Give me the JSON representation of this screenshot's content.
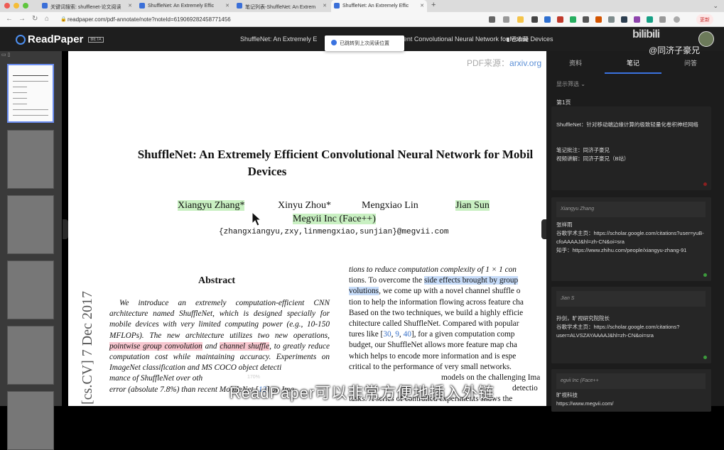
{
  "browser": {
    "tabs": [
      {
        "label": "关键词搜索: shufflenet-论文阅读"
      },
      {
        "label": "ShuffleNet: An Extremely Effic"
      },
      {
        "label": "笔记列表-ShuffleNet: An Extrem"
      },
      {
        "label": "ShuffleNet: An Extremely Effic"
      }
    ],
    "url": "readpaper.com/pdf-annotate/note?noteId=619069282458771456",
    "update_label": "更新"
  },
  "app": {
    "logo_text": "ReadPaper",
    "beta_label": "BETA",
    "doc_title": "ShuffleNet: An Extremely E",
    "doc_title_tail": "cient Convolutional Neural Network for Mobile Devices",
    "bookmark_label": "已收藏",
    "toast": "已跳转到上次阅读位置"
  },
  "overlay": {
    "watermark": "bilibili",
    "author": "@同济子豪兄",
    "caption": "ReadPaper可以非常方便地插入外链"
  },
  "pdf": {
    "source_label": "PDF来源：",
    "source_value": "arxiv.org",
    "title_line1": "ShuffleNet: An Extremely Efficient Convolutional Neural Network for Mobil",
    "title_line2": "Devices",
    "authors": [
      "Xiangyu Zhang*",
      "Xinyu Zhou*",
      "Mengxiao Lin",
      "Jian Sun"
    ],
    "affiliation": "Megvii Inc (Face++)",
    "email": "{zhangxiangyu,zxy,linmengxiao,sunjian}@megvii.com",
    "arxiv_stamp": "[cs.CV]  7 Dec 2017",
    "abstract_heading": "Abstract",
    "abstract": {
      "p1": "We introduce an extremely computation-efficient CNN architecture named ShuffleNet, which is designed specially for mobile devices with very limited computing power (e.g., 10-150 MFLOPs). The new architecture utilizes two new operations, ",
      "h1": "pointwise group convolution",
      "p2": " and ",
      "h2": "channel shuffle",
      "p3": ", to greatly reduce computation cost while maintaining accuracy. Experiments on ImageNet classification and MS COCO object detecti",
      "p4": "mance of ShuffleNet over oth",
      "p5": "error (absolute 7.8%) than recent MobileNet [",
      "cite": "12",
      "p6": "] on Ima-"
    },
    "right_lines": [
      "tions to reduce computation complexity of 1 × 1 con",
      "tions.  To overcome the ",
      "side effects brought by group",
      "volutions",
      ", we come up with a novel channel shuffle o",
      "tion to help the information flowing across feature cha",
      "Based on the two techniques, we build a highly efficie",
      "chitecture called ShuffleNet. Compared with popular",
      "tures like  [",
      "30",
      "9",
      "40",
      "], for a given computation comp",
      "budget, our ShuffleNet allows more feature map cha",
      "which helps to encode more information and is espe",
      "critical to the performance of very small networks.",
      "models on the challenging Ima",
      "detectio",
      "tasks.  A series of controlled experiments shows the"
    ],
    "zoom": "170%"
  },
  "panel": {
    "tabs": [
      "资料",
      "笔记",
      "问答"
    ],
    "filter_label": "显示筛选",
    "page_label": "第1页",
    "cards": [
      {
        "header": "",
        "body": "ShuffleNet：针对移动端边缘计算的极致轻量化卷积神经网络\n\n\n笔记批注：同济子豪兄\n视频讲解：同济子豪兄（B站）"
      },
      {
        "header": "Xiangyu Zhang",
        "body": "张祥雨\n谷歌学术主页：https://scholar.google.com/citations?user=yuB-cfoAAAAJ&hl=zh-CN&oi=sra\n知乎：https://www.zhihu.com/people/xiangyu-zhang-91"
      },
      {
        "header": "Jian S",
        "body": "孙剑，旷视研究院院长\n谷歌学术主页：https://scholar.google.com/citations?user=ALVSZAYAAAAJ&hl=zh-CN&oi=sra"
      },
      {
        "header": "egvii Inc (Face++",
        "body": "旷视科技\nhttps://www.megvii.com/"
      }
    ]
  }
}
